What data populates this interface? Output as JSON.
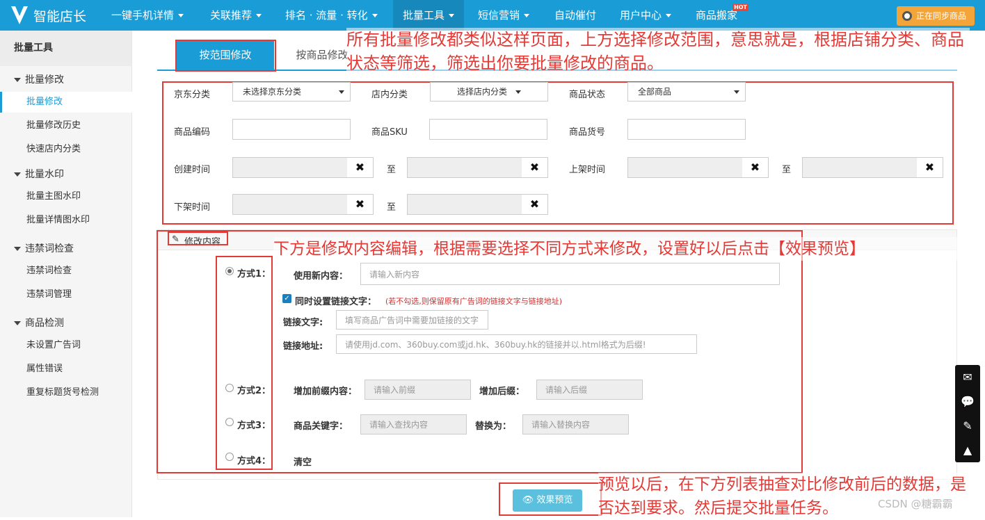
{
  "app": {
    "name": "智能店长"
  },
  "nav": {
    "items": [
      "一键手机详情",
      "关联推荐",
      "排名 · 流量 · 转化",
      "批量工具",
      "短信营销",
      "自动催付",
      "用户中心",
      "商品搬家"
    ],
    "hot_badge": "HOT",
    "sync_label": "正在同步商品"
  },
  "sidebar": {
    "title": "批量工具",
    "groups": [
      {
        "label": "批量修改",
        "items": [
          "批量修改",
          "批量修改历史",
          "快速店内分类"
        ]
      },
      {
        "label": "批量水印",
        "items": [
          "批量主图水印",
          "批量详情图水印"
        ]
      },
      {
        "label": "违禁词检查",
        "items": [
          "违禁词检查",
          "违禁词管理"
        ]
      },
      {
        "label": "商品检测",
        "items": [
          "未设置广告词",
          "属性错误",
          "重复标题货号检测"
        ]
      }
    ]
  },
  "tabs": [
    "按范围修改",
    "按商品修改"
  ],
  "filters": {
    "jd_category_label": "京东分类",
    "jd_category_value": "未选择京东分类",
    "shop_category_label": "店内分类",
    "shop_category_value": "选择店内分类",
    "status_label": "商品状态",
    "status_value": "全部商品",
    "code_label": "商品编码",
    "sku_label": "商品SKU",
    "item_no_label": "商品货号",
    "created_label": "创建时间",
    "listed_label": "上架时间",
    "delisted_label": "下架时间",
    "to": "至"
  },
  "edit": {
    "section_title": "修改内容",
    "mode1": "方式1：",
    "mode2": "方式2：",
    "mode3": "方式3：",
    "mode4": "方式4：",
    "use_new_label": "使用新内容：",
    "use_new_placeholder": "请输入新内容",
    "link_checkbox_label": "同时设置链接文字：",
    "link_hint": "(若不勾选,则保留原有广告词的链接文字与链接地址)",
    "link_text_label": "链接文字:",
    "link_text_placeholder": "填写商品广告词中需要加链接的文字",
    "link_url_label": "链接地址:",
    "link_url_placeholder": "请使用jd.com、360buy.com或jd.hk、360buy.hk的链接并以.html格式为后缀!",
    "prefix_label": "增加前缀内容：",
    "prefix_placeholder": "请输入前缀",
    "suffix_label": "增加后缀：",
    "suffix_placeholder": "请输入后缀",
    "keyword_label": "商品关键字：",
    "keyword_placeholder": "请输入查找内容",
    "replace_label": "替换为：",
    "replace_placeholder": "请输入替换内容",
    "clear_label": "清空",
    "preview_label": "效果预览"
  },
  "annotations": {
    "top": "所有批量修改都类似这样页面，上方选择修改范围，意思就是，根据店铺分类、商品状态等筛选，筛选出你要批量修改的商品。",
    "middle": "下方是修改内容编辑，根据需要选择不同方式来修改，设置好以后点击【效果预览】",
    "bottom": "预览以后，在下方列表抽查对比修改前后的数据，是否达到要求。然后提交批量任务。"
  },
  "watermark": "CSDN @糖霸霸"
}
